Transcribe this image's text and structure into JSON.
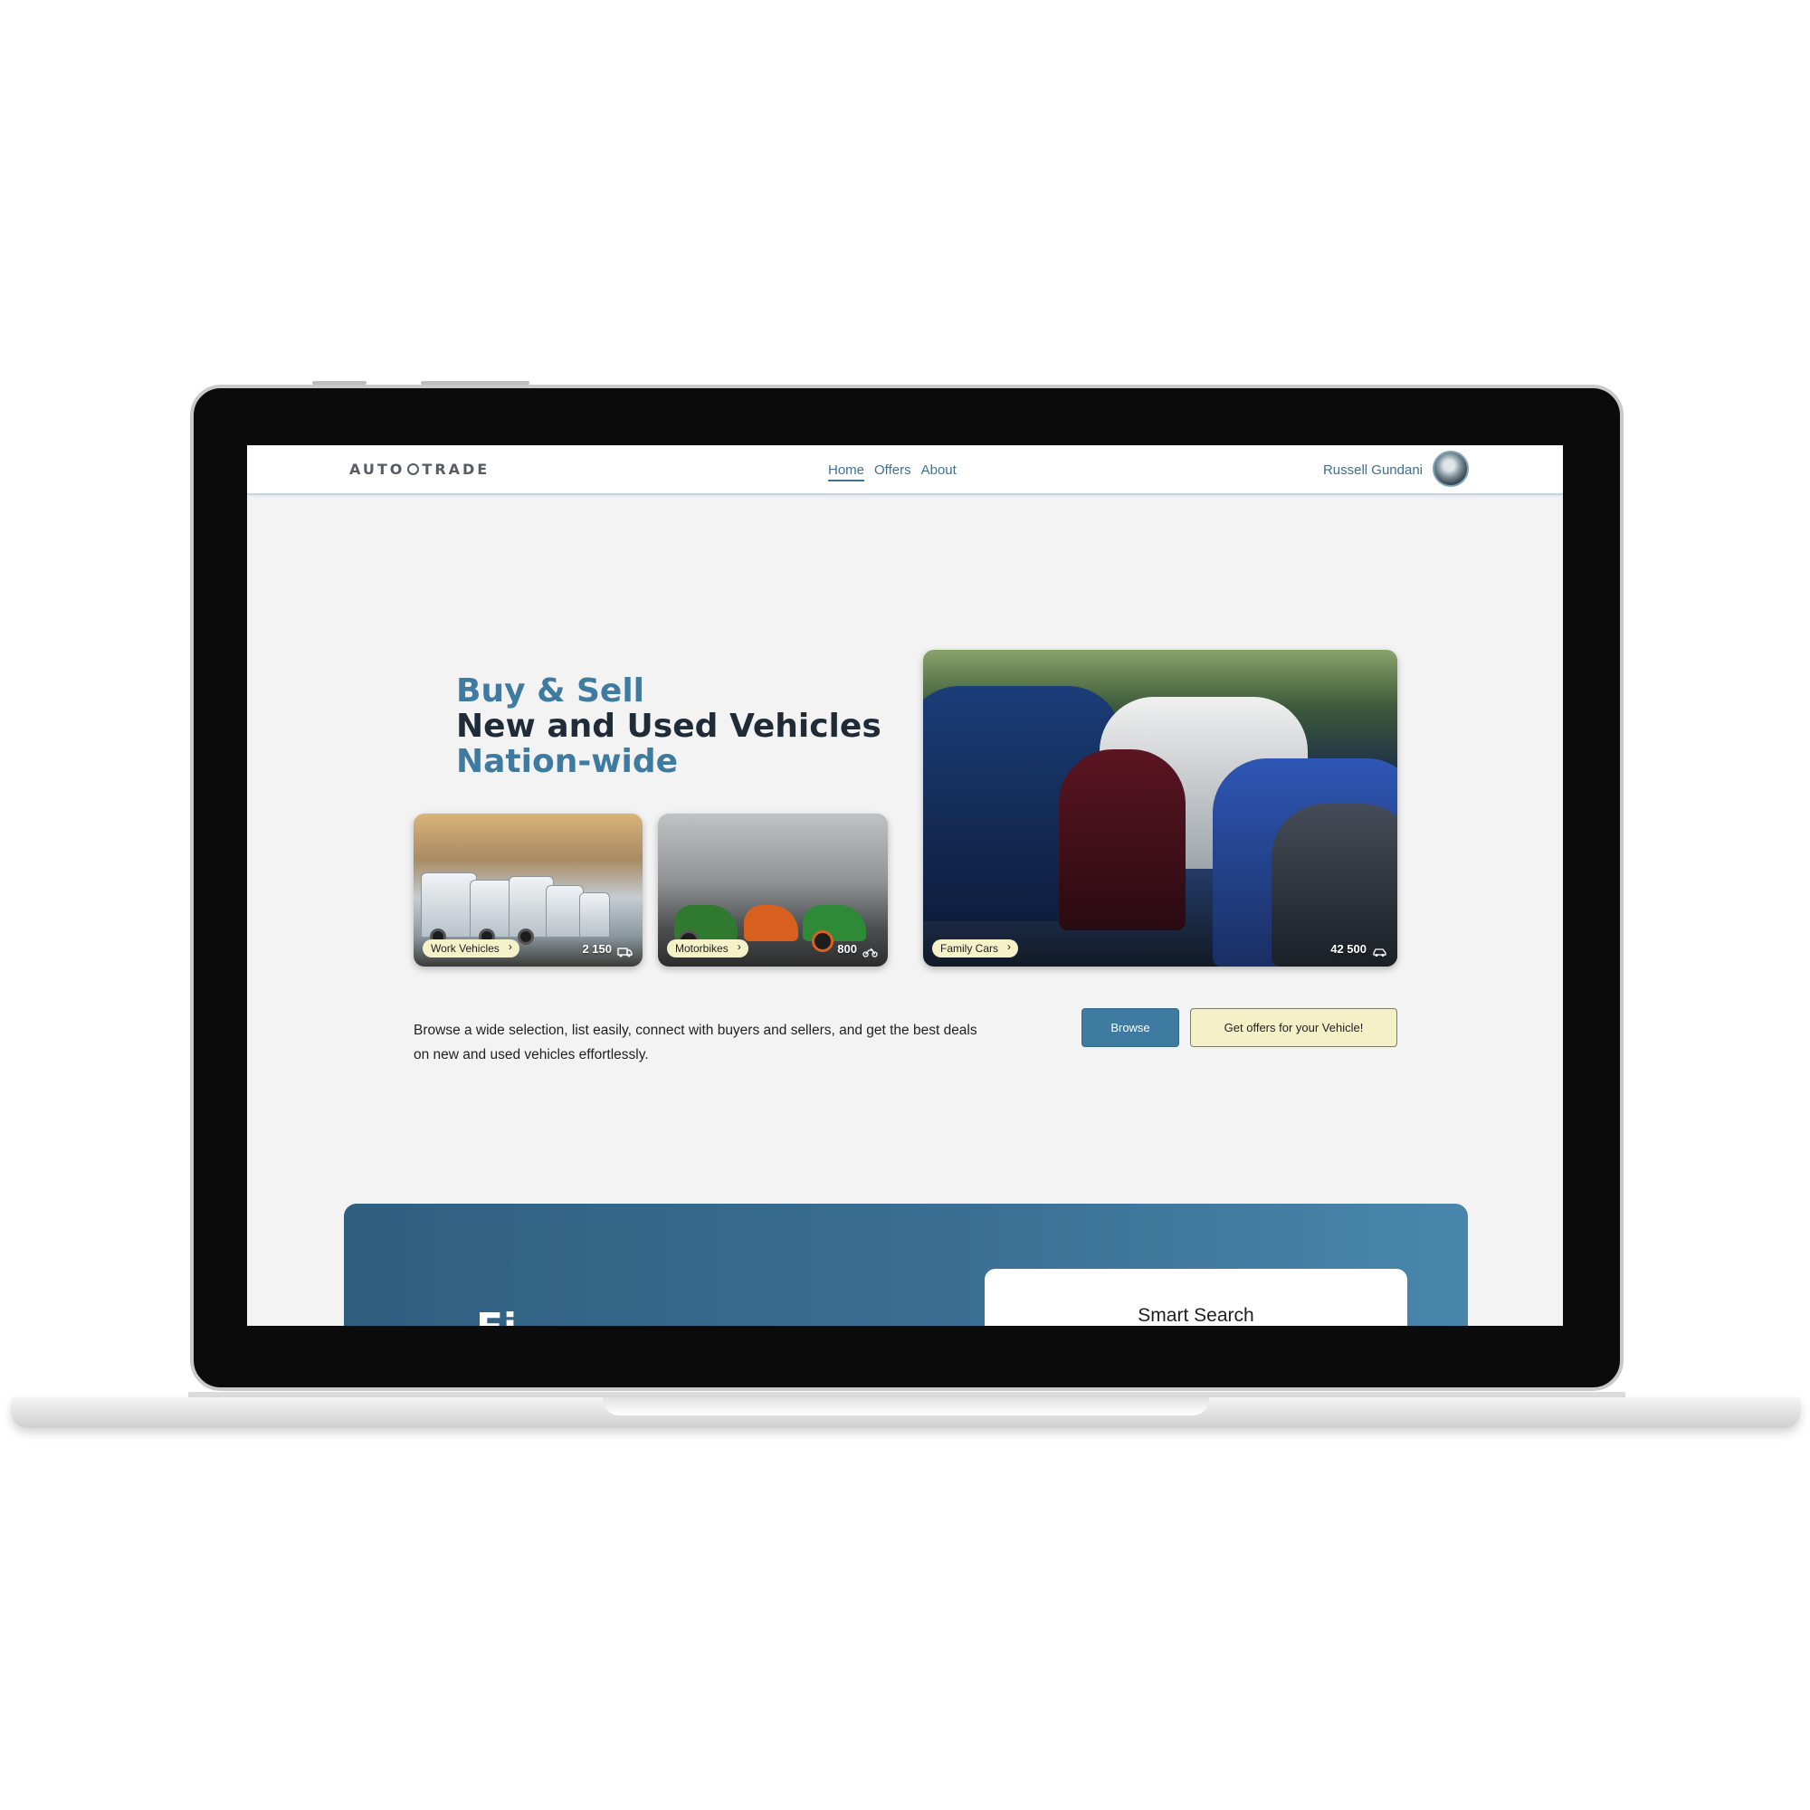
{
  "header": {
    "logo_part1": "AUTO",
    "logo_part2": "TRADE",
    "nav": [
      "Home",
      "Offers",
      "About"
    ],
    "active_nav": "Home",
    "user_name": "Russell Gundani"
  },
  "hero": {
    "line1": "Buy & Sell",
    "line2": "New and Used Vehicles",
    "line3": "Nation-wide"
  },
  "categories": [
    {
      "label": "Work Vehicles",
      "count": "2 150",
      "icon": "truck-icon"
    },
    {
      "label": "Motorbikes",
      "count": "800",
      "icon": "motorbike-icon"
    },
    {
      "label": "Family Cars",
      "count": "42 500",
      "icon": "car-icon"
    }
  ],
  "description": "Browse a wide selection, list easily, connect with buyers and sellers, and get the best deals on new and used vehicles effortlessly.",
  "buttons": {
    "browse": "Browse",
    "offers": "Get offers for your Vehicle!"
  },
  "search_panel": {
    "title_partial": "Fi",
    "card_title": "Smart Search"
  },
  "colors": {
    "accent": "#3f7aa0",
    "dark_text": "#1f2c38",
    "pill_bg": "#f5f1c8",
    "background": "#f3f3f3"
  }
}
